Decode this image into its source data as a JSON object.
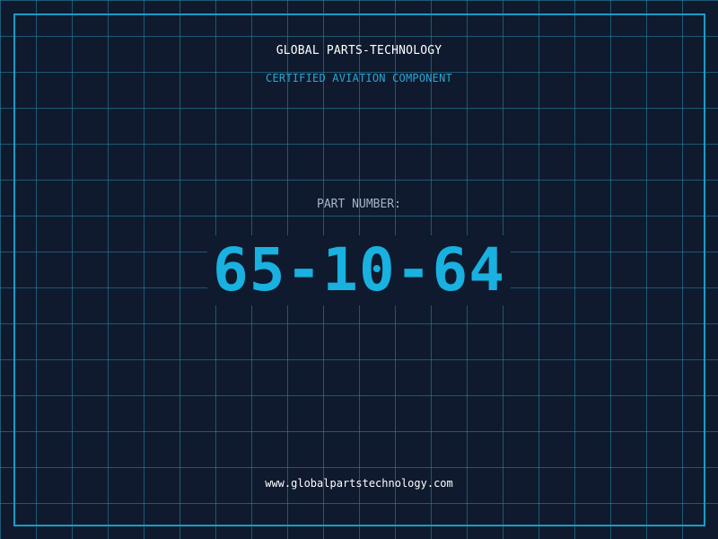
{
  "header": {
    "brand": "GLOBAL PARTS-TECHNOLOGY",
    "tagline": "CERTIFIED AVIATION COMPONENT"
  },
  "part": {
    "label": "PART NUMBER:",
    "number": "65-10-64"
  },
  "footer": {
    "url": "www.globalpartstechnology.com"
  },
  "colors": {
    "background": "#0f1a2e",
    "grid": "#268caa",
    "frame": "#1a9cc6",
    "accent": "#18b1e0"
  }
}
